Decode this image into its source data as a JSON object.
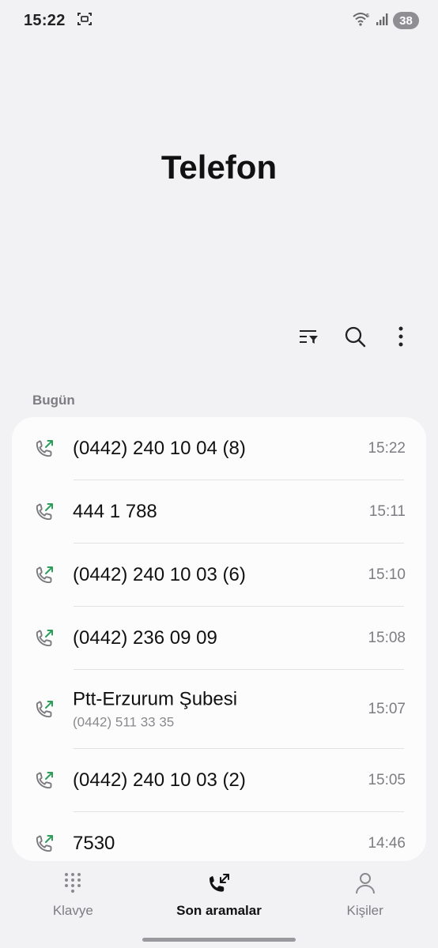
{
  "status_bar": {
    "time": "15:22",
    "battery": "38",
    "icons": [
      "screenshot-icon",
      "wifi-icon",
      "signal-icon",
      "battery-icon"
    ]
  },
  "header": {
    "title": "Telefon"
  },
  "toolbar": {
    "icons": [
      "filter-icon",
      "search-icon",
      "more-options-icon"
    ]
  },
  "section": {
    "label": "Bugün"
  },
  "calls": [
    {
      "title": "(0442) 240 10 04 (8)",
      "subtitle": "",
      "time": "15:22",
      "icon": "outgoing-call-icon"
    },
    {
      "title": "444 1 788",
      "subtitle": "",
      "time": "15:11",
      "icon": "outgoing-call-icon"
    },
    {
      "title": "(0442) 240 10 03 (6)",
      "subtitle": "",
      "time": "15:10",
      "icon": "outgoing-call-icon"
    },
    {
      "title": "(0442) 236 09 09",
      "subtitle": "",
      "time": "15:08",
      "icon": "outgoing-call-icon"
    },
    {
      "title": "Ptt-Erzurum Şubesi",
      "subtitle": "(0442) 511 33 35",
      "time": "15:07",
      "icon": "outgoing-call-icon"
    },
    {
      "title": "(0442) 240 10 03 (2)",
      "subtitle": "",
      "time": "15:05",
      "icon": "outgoing-call-icon"
    },
    {
      "title": "7530",
      "subtitle": "",
      "time": "14:46",
      "icon": "outgoing-call-icon"
    }
  ],
  "nav": {
    "keypad": "Klavye",
    "recents": "Son aramalar",
    "contacts": "Kişiler"
  },
  "colors": {
    "background": "#f2f2f4",
    "card": "#fcfcfd",
    "outgoing_arrow": "#2e9e5b",
    "secondary_text": "#7d7d82"
  }
}
